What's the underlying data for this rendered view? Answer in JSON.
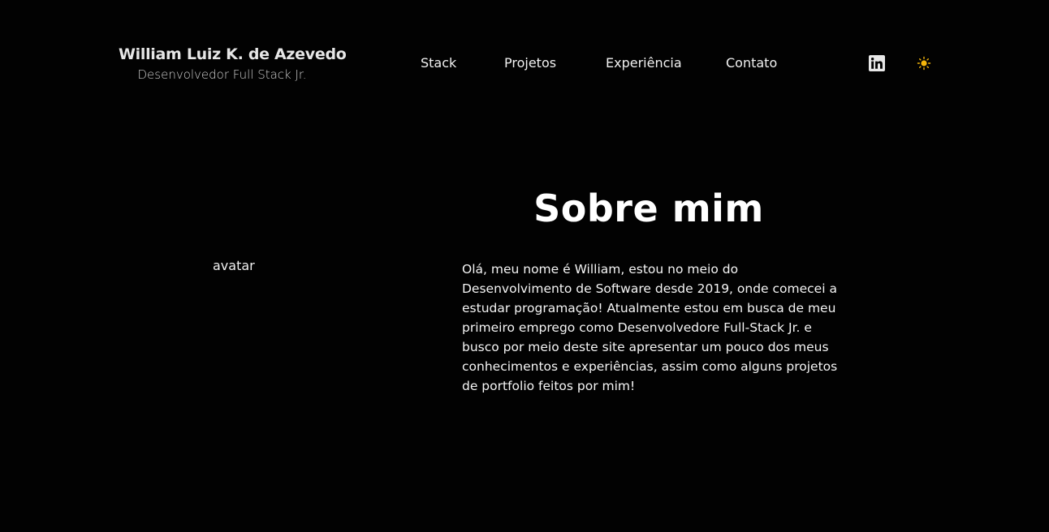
{
  "header": {
    "name": "William Luiz K. de Azevedo",
    "role": "Desenvolvedor Full Stack Jr."
  },
  "nav": {
    "items": [
      {
        "label": "Stack"
      },
      {
        "label": "Projetos"
      },
      {
        "label": "Experiência"
      },
      {
        "label": "Contato"
      }
    ]
  },
  "icons": {
    "linkedin": "linkedin-icon",
    "theme_toggle": "sun-icon"
  },
  "colors": {
    "background": "#020202",
    "text": "#ffffff",
    "sun": "#f5b60b"
  },
  "about": {
    "avatar_alt": "avatar",
    "title": "Sobre mim",
    "text": "Olá, meu nome é William, estou no meio do Desenvolvimento de Software desde 2019, onde comecei a estudar programação! Atualmente estou em busca de meu primeiro emprego como Desenvolvedore Full-Stack Jr. e busco por meio deste site apresentar um pouco dos meus conhecimentos e experiências, assim como alguns projetos de portfolio feitos por mim!"
  }
}
